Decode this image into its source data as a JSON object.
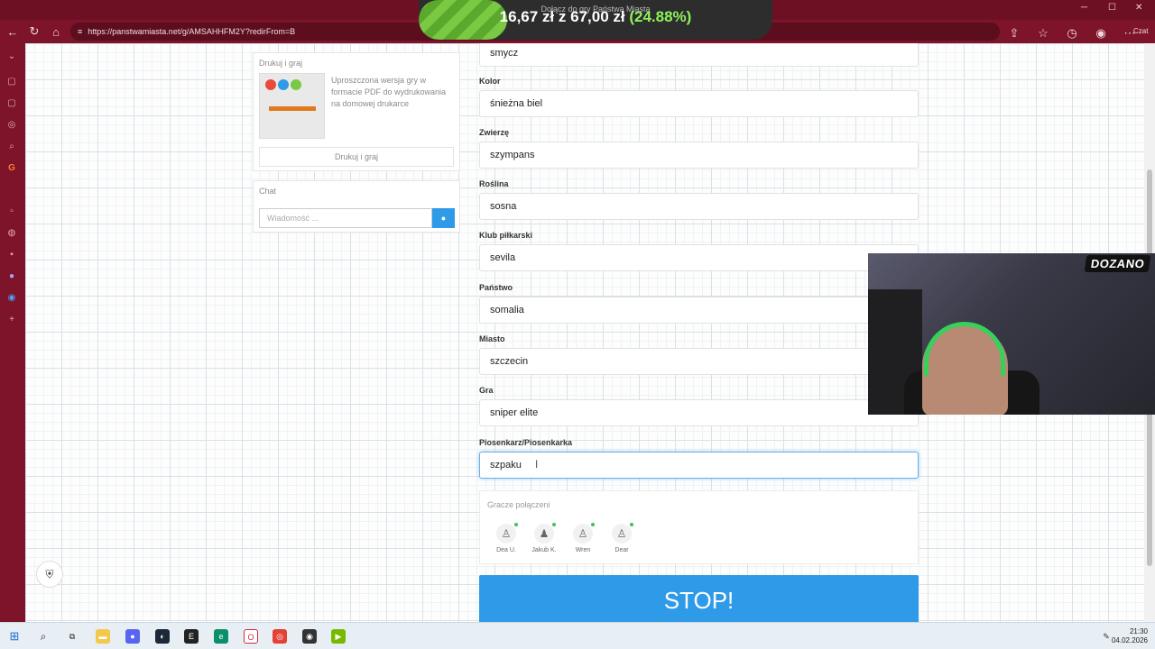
{
  "browser": {
    "url": "https://panstwamiasta.net/g/AMSAHHFM2Y?redirFrom=B",
    "chat_label": "Czat"
  },
  "donation": {
    "caption": "Dołącz do gry Państwa Miasta",
    "amount": "16,67 zł",
    "connector": "z",
    "goal": "67,00 zł",
    "percent_text": "(24.88%)",
    "progress": 0.2488
  },
  "left_panel": {
    "print": {
      "title": "Drukuj i graj",
      "description": "Uproszczona wersja gry w formacie PDF do wydrukowania na domowej drukarce",
      "button": "Drukuj i graj"
    },
    "chat": {
      "title": "Chat",
      "placeholder": "Wiadomość ...",
      "send_icon": "chat-bubble-icon"
    }
  },
  "form": {
    "top_value": "smycz",
    "fields": [
      {
        "label": "Kolor",
        "value": "śnieżna biel"
      },
      {
        "label": "Zwierzę",
        "value": "szympans"
      },
      {
        "label": "Roślina",
        "value": "sosna"
      },
      {
        "label": "Klub piłkarski",
        "value": "sevila"
      },
      {
        "label": "Państwo",
        "value": "somalia"
      },
      {
        "label": "Miasto",
        "value": "szczecin"
      },
      {
        "label": "Gra",
        "value": "sniper elite"
      },
      {
        "label": "Piosenkarz/Piosenkarka",
        "value": "szpaku"
      }
    ]
  },
  "players": {
    "title": "Gracze połączeni",
    "list": [
      {
        "name": "Dea U."
      },
      {
        "name": "Jakub K."
      },
      {
        "name": "Wren"
      },
      {
        "name": "Dear"
      }
    ]
  },
  "stop_button": "STOP!",
  "webcam": {
    "logo": "DOZANO"
  },
  "taskbar": {
    "time": "21:30",
    "date": "04.02.2026"
  },
  "colors": {
    "browser_frame": "#7d1429",
    "primary_button": "#2f9ae8",
    "online_dot": "#3cc35a",
    "donation_fill": "#7ac943"
  }
}
